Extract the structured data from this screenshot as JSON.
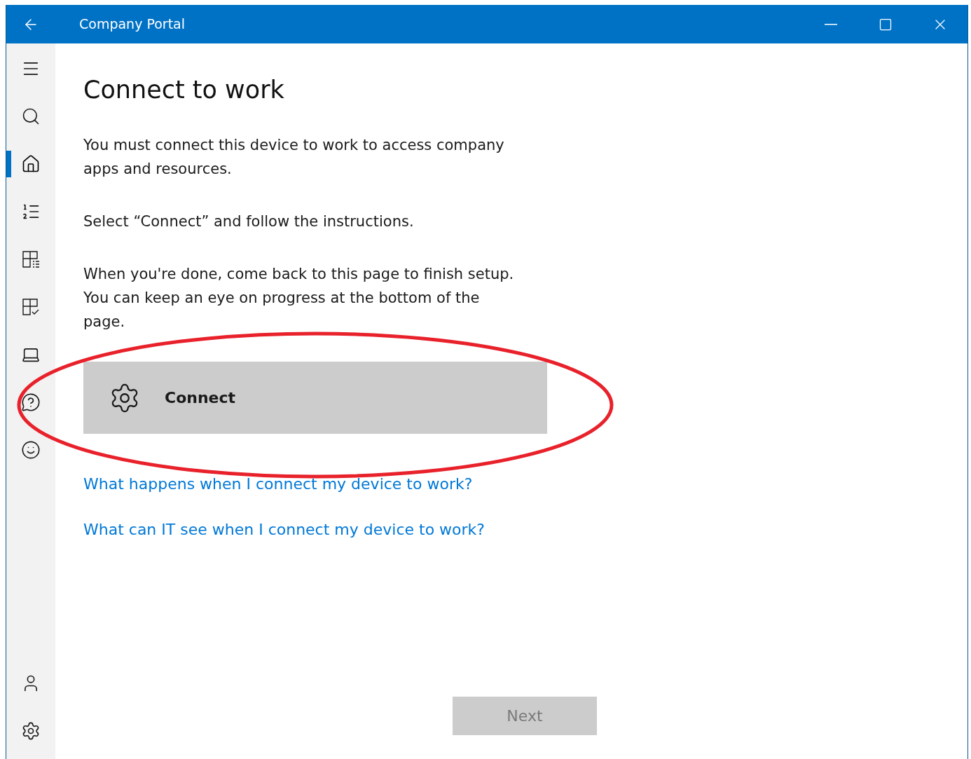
{
  "window": {
    "title": "Company Portal"
  },
  "sidebar": {
    "items": [
      {
        "kind": "menu",
        "selected": false
      },
      {
        "kind": "search",
        "selected": false
      },
      {
        "kind": "home",
        "selected": true
      },
      {
        "kind": "list",
        "selected": false
      },
      {
        "kind": "grid-list",
        "selected": false
      },
      {
        "kind": "grid-check",
        "selected": false
      },
      {
        "kind": "laptop",
        "selected": false
      },
      {
        "kind": "help",
        "selected": false
      },
      {
        "kind": "smiley",
        "selected": false
      }
    ],
    "bottom_items": [
      {
        "kind": "person",
        "selected": false
      },
      {
        "kind": "settings",
        "selected": false
      }
    ]
  },
  "page": {
    "title": "Connect to work",
    "paragraphs": [
      "You must connect this device to work to access company apps and resources.",
      "Select “Connect” and follow the instructions.",
      "When you're done, come back to this page to finish setup. You can keep an eye on progress at the bottom of the page."
    ],
    "connect_button": {
      "label": "Connect"
    },
    "links": [
      "What happens when I connect my device to work?",
      "What can IT see when I connect my device to work?"
    ],
    "next_button": {
      "label": "Next",
      "disabled": true
    }
  },
  "annotation": {
    "kind": "ellipse",
    "color": "#e8212b"
  }
}
